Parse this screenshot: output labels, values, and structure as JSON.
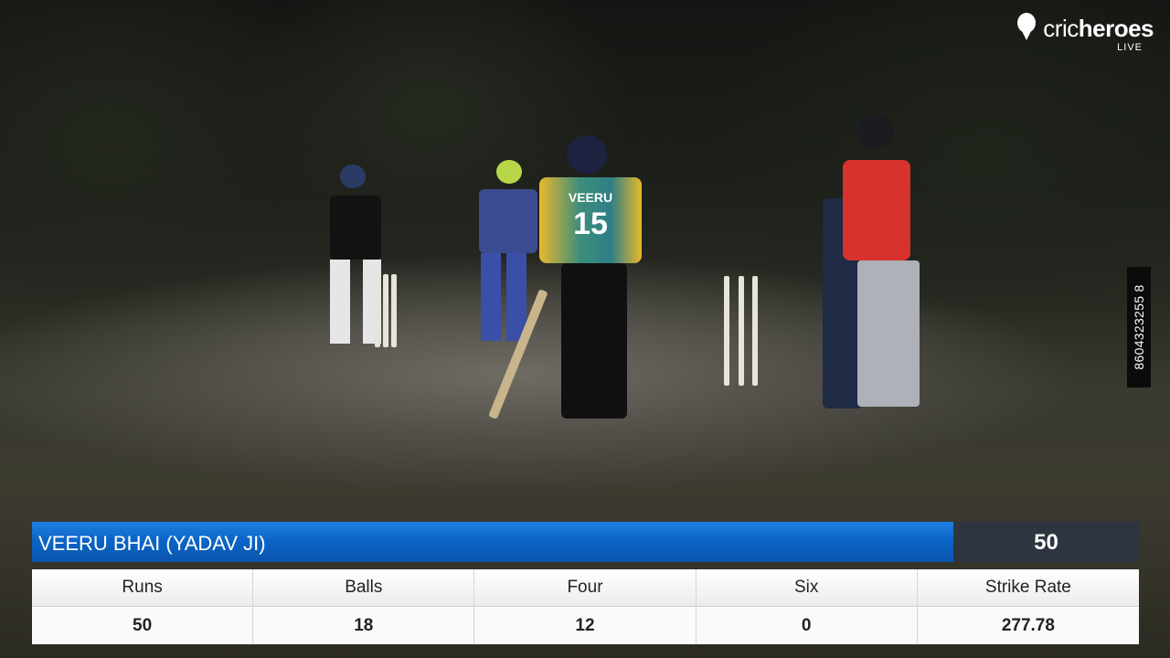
{
  "overlay": {
    "brand_name_light": "cric",
    "brand_name_bold": "heroes",
    "brand_tag": "LIVE",
    "phone_number": "8604323255 8"
  },
  "jersey": {
    "name": "VEERU",
    "number": "15"
  },
  "player_card": {
    "name": "VEERU BHAI (YADAV JI)",
    "score": "50",
    "headers": [
      "Runs",
      "Balls",
      "Four",
      "Six",
      "Strike Rate"
    ],
    "values": [
      "50",
      "18",
      "12",
      "0",
      "277.78"
    ]
  },
  "colors": {
    "name_bar": "#0b63c4",
    "score_box": "#2d3640",
    "stats_bg": "#f4f4f4"
  }
}
